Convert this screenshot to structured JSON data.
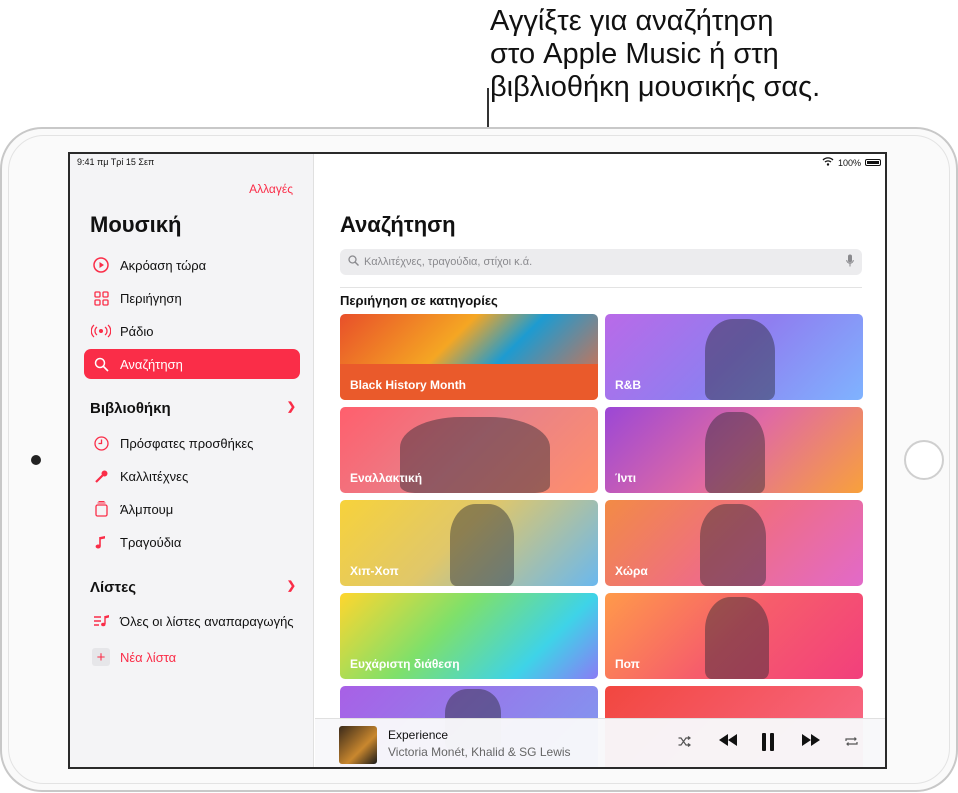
{
  "callout": {
    "lines": [
      "Αγγίξτε για αναζήτηση",
      "στο Apple Music ή στη",
      "βιβλιοθήκη μουσικής σας."
    ]
  },
  "status": {
    "time": "9:41 πμ",
    "date": "Τρί 15 Σεπ",
    "battery": "100%"
  },
  "sidebar": {
    "edit": "Αλλαγές",
    "title": "Μουσική",
    "nav": [
      {
        "label": "Ακρόαση τώρα",
        "icon": "play-circle-icon"
      },
      {
        "label": "Περιήγηση",
        "icon": "grid-icon"
      },
      {
        "label": "Ράδιο",
        "icon": "radio-icon"
      },
      {
        "label": "Αναζήτηση",
        "icon": "search-icon",
        "active": true
      }
    ],
    "library_title": "Βιβλιοθήκη",
    "library": [
      {
        "label": "Πρόσφατες προσθήκες",
        "icon": "clock-icon"
      },
      {
        "label": "Καλλιτέχνες",
        "icon": "microphone-icon"
      },
      {
        "label": "Άλμπουμ",
        "icon": "album-icon"
      },
      {
        "label": "Τραγούδια",
        "icon": "note-icon"
      }
    ],
    "lists_title": "Λίστες",
    "lists": [
      {
        "label": "Όλες οι λίστες αναπαραγωγής",
        "icon": "playlist-icon"
      },
      {
        "label": "Νέα λίστα",
        "icon": "plus-icon"
      }
    ]
  },
  "main": {
    "title": "Αναζήτηση",
    "search_placeholder": "Καλλιτέχνες, τραγούδια, στίχοι κ.ά.",
    "section": "Περιήγηση σε κατηγορίες",
    "categories": [
      "Black History Month",
      "R&B",
      "Εναλλακτική",
      "Ίντι",
      "Χιπ-Χοπ",
      "Χώρα",
      "Ευχάριστη διάθεση",
      "Ποπ"
    ]
  },
  "player": {
    "title": "Experience",
    "artist": "Victoria Monét, Khalid & SG Lewis"
  },
  "colors": {
    "accent": "#fa2d48"
  }
}
